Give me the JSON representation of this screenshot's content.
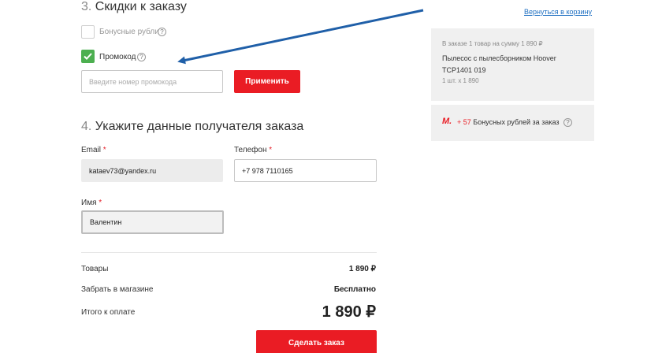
{
  "discounts": {
    "number": "3.",
    "title": "Скидки к заказу",
    "bonus_label": "Бонусные рубли",
    "promo_label": "Промокод",
    "help_glyph": "?",
    "promo_placeholder": "Введите номер промокода",
    "apply_label": "Применить"
  },
  "recipient": {
    "number": "4.",
    "title": "Укажите данные получателя заказа",
    "email_label": "Email",
    "email_value": "kataev73@yandex.ru",
    "phone_label": "Телефон",
    "phone_value": "+7 978 7110165",
    "name_label": "Имя",
    "name_value": "Валентин",
    "required_mark": "*"
  },
  "summary": {
    "goods_label": "Товары",
    "goods_value": "1 890 ₽",
    "pickup_label": "Забрать в магазине",
    "pickup_value": "Бесплатно",
    "total_label": "Итого к оплате",
    "total_value": "1 890 ₽",
    "submit_label": "Сделать заказ"
  },
  "sidebar": {
    "back_link": "Вернуться в корзину",
    "order_info": "В заказе 1 товар на сумму 1 890 ₽",
    "product_name": "Пылесос с пылесборником Hoover TCP1401 019",
    "quantity": "1 шт. x 1 890",
    "bonus_logo": "М.",
    "bonus_amount": "+ 57",
    "bonus_text": "Бонусных рублей за заказ"
  },
  "colors": {
    "accent_red": "#ea1c24",
    "check_green": "#4caf50",
    "link_blue": "#1e6fc2",
    "arrow_blue": "#1f5fa8"
  }
}
